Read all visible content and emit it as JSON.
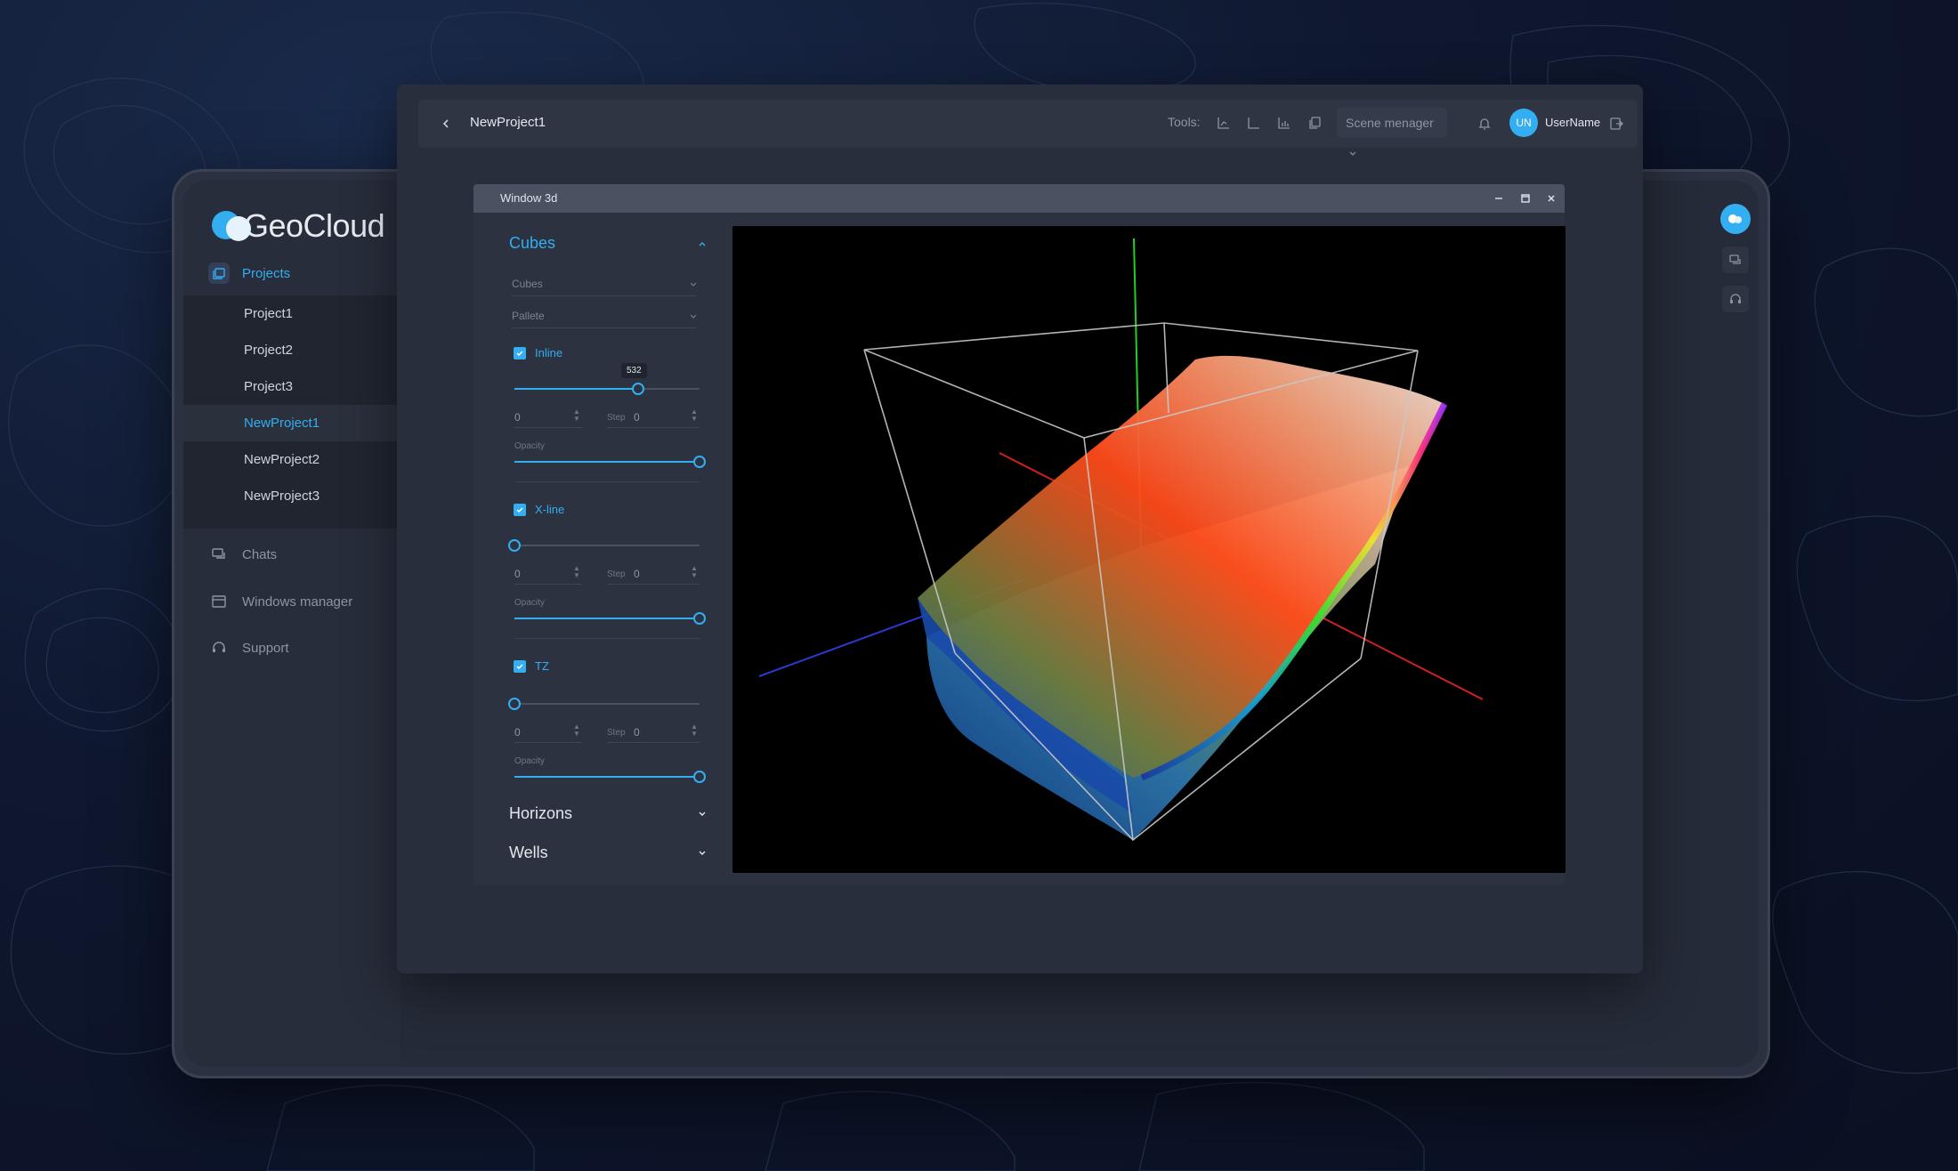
{
  "brand": {
    "name_part1": "Geo",
    "name_part2": "Cloud"
  },
  "sidebar": {
    "projects_label": "Projects",
    "projects": [
      {
        "label": "Project1",
        "active": false
      },
      {
        "label": "Project2",
        "active": false
      },
      {
        "label": "Project3",
        "active": false
      },
      {
        "label": "NewProject1",
        "active": true
      },
      {
        "label": "NewProject2",
        "active": false
      },
      {
        "label": "NewProject3",
        "active": false
      }
    ],
    "chats_label": "Chats",
    "windows_label": "Windows manager",
    "support_label": "Support"
  },
  "topbar": {
    "project_title": "NewProject1",
    "tools_label": "Tools:",
    "scene_manager": "Scene menager",
    "user_initials": "UN",
    "user_name": "UserName"
  },
  "window3d": {
    "title": "Window 3d",
    "cubes": {
      "title": "Cubes",
      "select_cubes": "Cubes",
      "select_pallete": "Pallete",
      "inline": {
        "label": "Inline",
        "checked": true,
        "slider_value": 532,
        "slider_fraction": 0.67,
        "min": "0",
        "step_label": "Step",
        "step": "0",
        "opacity_label": "Opacity",
        "opacity": 1.0
      },
      "xline": {
        "label": "X-line",
        "checked": true,
        "slider_fraction": 0.0,
        "min": "0",
        "step_label": "Step",
        "step": "0",
        "opacity_label": "Opacity",
        "opacity": 1.0
      },
      "tz": {
        "label": "TZ",
        "checked": true,
        "slider_fraction": 0.0,
        "min": "0",
        "step_label": "Step",
        "step": "0",
        "opacity_label": "Opacity",
        "opacity": 1.0
      }
    },
    "horizons_label": "Horizons",
    "wells_label": "Wells"
  },
  "colors": {
    "accent": "#33aef0",
    "panel": "#2c3240",
    "viewport_bg": "#000000"
  }
}
